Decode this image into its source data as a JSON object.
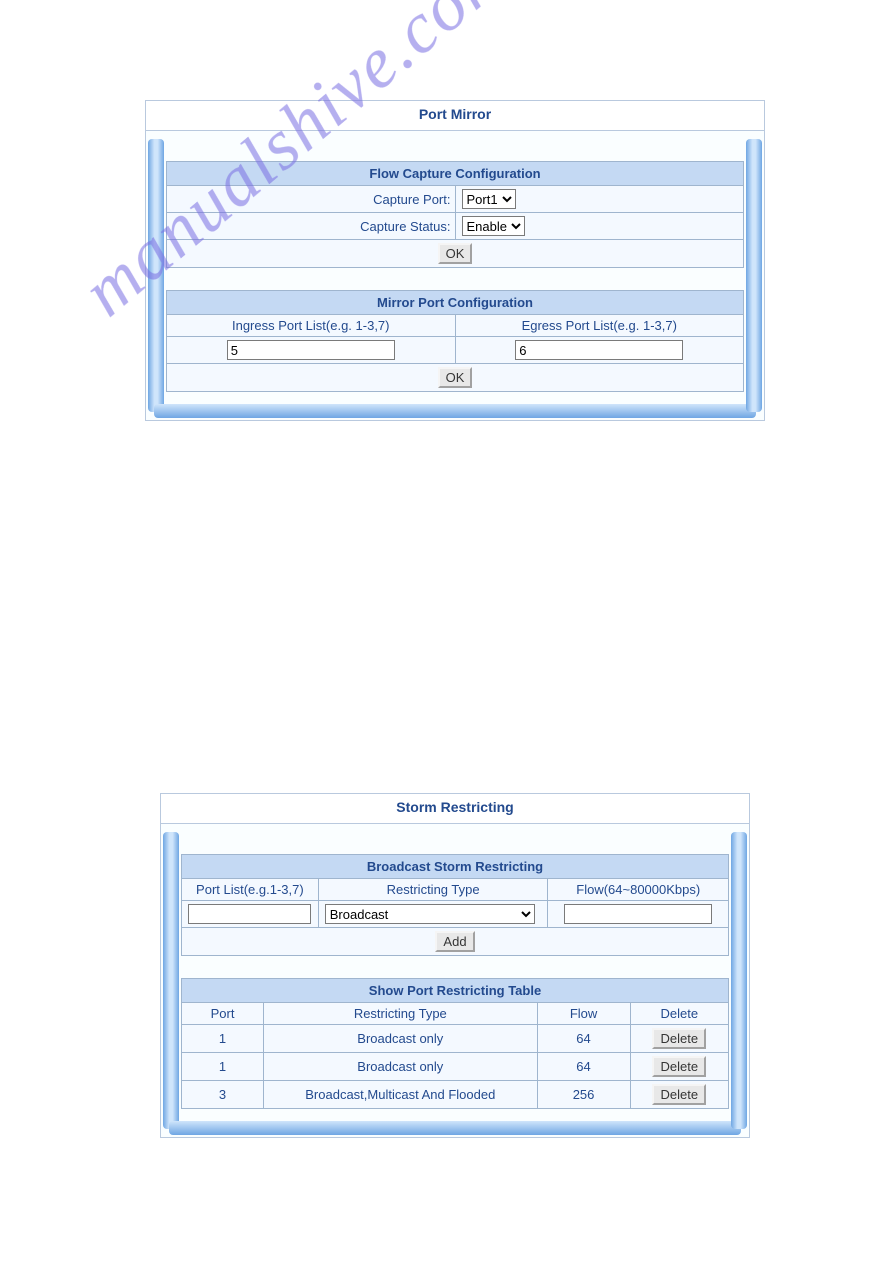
{
  "watermark": "manualshive.com",
  "portMirror": {
    "title": "Port Mirror",
    "flowCapture": {
      "header": "Flow Capture Configuration",
      "capturePortLabel": "Capture Port:",
      "capturePortValue": "Port1",
      "captureStatusLabel": "Capture Status:",
      "captureStatusValue": "Enable",
      "ok": "OK"
    },
    "mirrorPort": {
      "header": "Mirror Port Configuration",
      "ingressLabel": "Ingress Port List(e.g. 1-3,7)",
      "ingressValue": "5",
      "egressLabel": "Egress Port List(e.g. 1-3,7)",
      "egressValue": "6",
      "ok": "OK"
    }
  },
  "storm": {
    "title": "Storm Restricting",
    "broadcast": {
      "header": "Broadcast Storm Restricting",
      "portListLabel": "Port List(e.g.1-3,7)",
      "portListValue": "",
      "restrictingTypeLabel": "Restricting Type",
      "restrictingTypeValue": "Broadcast",
      "flowLabel": "Flow(64~80000Kbps)",
      "flowValue": "",
      "add": "Add"
    },
    "table": {
      "header": "Show Port Restricting Table",
      "colPort": "Port",
      "colType": "Restricting Type",
      "colFlow": "Flow",
      "colDelete": "Delete",
      "rows": [
        {
          "port": "1",
          "type": "Broadcast only",
          "flow": "64",
          "del": "Delete"
        },
        {
          "port": "1",
          "type": "Broadcast only",
          "flow": "64",
          "del": "Delete"
        },
        {
          "port": "3",
          "type": "Broadcast,Multicast And Flooded",
          "flow": "256",
          "del": "Delete"
        }
      ]
    }
  }
}
